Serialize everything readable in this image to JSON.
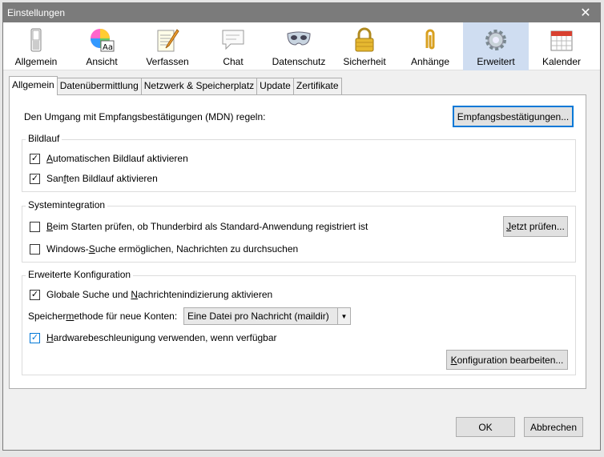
{
  "window": {
    "title": "Einstellungen"
  },
  "toolbar": [
    {
      "label": "Allgemein",
      "icon": "switch-icon"
    },
    {
      "label": "Ansicht",
      "icon": "color-wheel-icon"
    },
    {
      "label": "Verfassen",
      "icon": "notepad-pencil-icon"
    },
    {
      "label": "Chat",
      "icon": "speech-bubble-icon"
    },
    {
      "label": "Datenschutz",
      "icon": "mask-icon"
    },
    {
      "label": "Sicherheit",
      "icon": "padlock-icon"
    },
    {
      "label": "Anhänge",
      "icon": "paperclip-icon"
    },
    {
      "label": "Erweitert",
      "icon": "gear-icon",
      "selected": true
    },
    {
      "label": "Kalender",
      "icon": "calendar-icon"
    }
  ],
  "tabs": [
    "Allgemein",
    "Datenübermittlung",
    "Netzwerk & Speicherplatz",
    "Update",
    "Zertifikate"
  ],
  "mdn": {
    "label": "Den Umgang mit Empfangsbestätigungen (MDN) regeln:",
    "button": "Empfangsbestätigungen..."
  },
  "scrolling": {
    "legend": "Bildlauf",
    "auto": {
      "pre": "",
      "u": "A",
      "post": "utomatischen Bildlauf aktivieren",
      "checked": true
    },
    "smooth": {
      "pre": "San",
      "u": "f",
      "post": "ten Bildlauf aktivieren",
      "checked": true
    }
  },
  "system": {
    "legend": "Systemintegration",
    "check_default": {
      "pre": "",
      "u": "B",
      "post": "eim Starten prüfen, ob Thunderbird als Standard-Anwendung registriert ist",
      "checked": false
    },
    "check_now_button": {
      "pre": "",
      "u": "J",
      "post": "etzt prüfen..."
    },
    "windows_search": {
      "pre": "Windows-",
      "u": "S",
      "post": "uche ermöglichen, Nachrichten zu durchsuchen",
      "checked": false
    }
  },
  "advanced": {
    "legend": "Erweiterte Konfiguration",
    "global_search": {
      "pre": "Globale Suche und ",
      "u": "N",
      "post": "achrichtenindizierung aktivieren",
      "checked": true
    },
    "storage_label": {
      "pre": "Speicher",
      "u": "m",
      "post": "ethode für neue Konten:"
    },
    "storage_value": "Eine Datei pro Nachricht (maildir)",
    "hw_accel": {
      "pre": "",
      "u": "H",
      "post": "ardwarebeschleunigung verwenden, wenn verfügbar",
      "checked": true
    },
    "config_button": {
      "pre": "",
      "u": "K",
      "post": "onfiguration bearbeiten..."
    }
  },
  "footer": {
    "ok": "OK",
    "cancel": "Abbrechen"
  },
  "colors": {
    "titlebar": "#7b7b7b",
    "selected_toolbar": "#cfddf1",
    "focus_blue": "#0078d7"
  }
}
